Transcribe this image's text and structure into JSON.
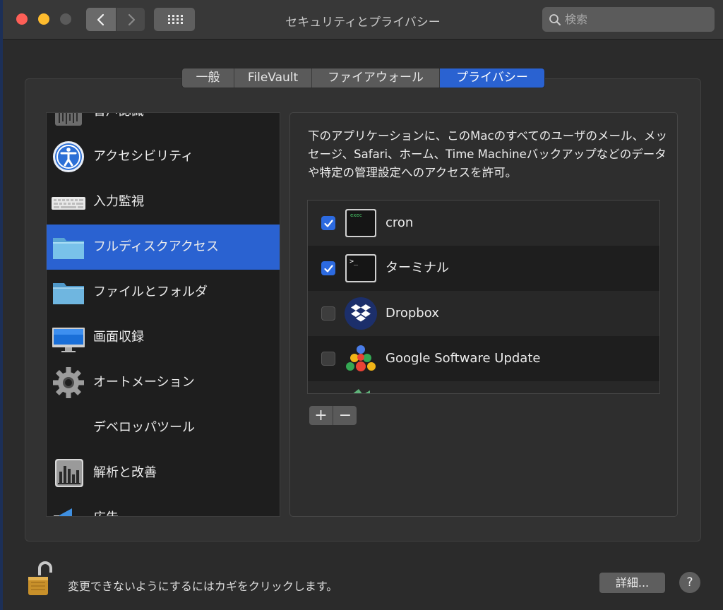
{
  "window": {
    "title": "セキュリティとプライバシー",
    "search_placeholder": "検索"
  },
  "tabs": [
    {
      "label": "一般",
      "active": false
    },
    {
      "label": "FileVault",
      "active": false
    },
    {
      "label": "ファイアウォール",
      "active": false
    },
    {
      "label": "プライバシー",
      "active": true
    }
  ],
  "sidebar": {
    "items": [
      {
        "label": "音声認識",
        "icon": "microphone-icon"
      },
      {
        "label": "アクセシビリティ",
        "icon": "accessibility-icon"
      },
      {
        "label": "入力監視",
        "icon": "keyboard-icon"
      },
      {
        "label": "フルディスクアクセス",
        "icon": "folder-icon",
        "selected": true
      },
      {
        "label": "ファイルとフォルダ",
        "icon": "folder-icon"
      },
      {
        "label": "画面収録",
        "icon": "display-icon"
      },
      {
        "label": "オートメーション",
        "icon": "gear-icon"
      },
      {
        "label": "デベロッパツール",
        "icon": ""
      },
      {
        "label": "解析と改善",
        "icon": "chart-icon"
      },
      {
        "label": "広告",
        "icon": "megaphone-icon"
      }
    ]
  },
  "main": {
    "description": "下のアプリケーションに、このMacのすべてのユーザのメール、メッセージ、Safari、ホーム、Time Machineバックアップなどのデータや特定の管理設定へのアクセスを許可。",
    "apps": [
      {
        "name": "cron",
        "checked": true,
        "icon": "exec-terminal-icon"
      },
      {
        "name": "ターミナル",
        "checked": true,
        "icon": "terminal-icon"
      },
      {
        "name": "Dropbox",
        "checked": false,
        "icon": "dropbox-icon"
      },
      {
        "name": "Google Software Update",
        "checked": false,
        "icon": "google-update-icon"
      }
    ],
    "add_label": "+",
    "remove_label": "−"
  },
  "footer": {
    "lock_text": "変更できないようにするにはカギをクリックします。",
    "details_label": "詳細...",
    "help_label": "?"
  }
}
